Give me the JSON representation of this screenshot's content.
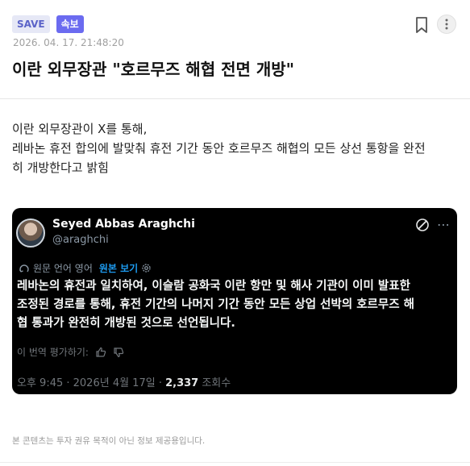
{
  "article": {
    "badges": {
      "save": "SAVE",
      "breaking": "속보"
    },
    "datetime": "2026. 04. 17. 21:48:20",
    "title": "이란 외무장관 \"호르무즈 해협 전면 개방\"",
    "body_lines": [
      "이란 외무장관이 X를 통해,",
      "레바논 휴전 합의에 발맞춰 휴전 기간 동안 호르무즈 해협의 모든 상선 통항을 완전",
      "히 개방한다고 밝힘"
    ]
  },
  "tweet": {
    "author_name": "Seyed Abbas Araghchi",
    "handle": "@araghchi",
    "original_language": "원문 언어 영어",
    "show_original": "원본 보기",
    "body_lines": [
      "레바논의 휴전과 일치하여, 이슬람 공화국 이란 항만 및 해사 기관이 이미 발표한",
      "조정된 경로를 통해, 휴전 기간의 나머지 기간 동안 모든 상업 선박의 호르무즈 해",
      "협 통과가 완전히 개방된 것으로 선언됩니다."
    ],
    "rate_translation": "이 번역 평가하기:",
    "timestamp": "오후 9:45 · 2026년 4월 17일 · ",
    "views_count": "2,337",
    "views_label": " 조회수"
  },
  "footer": {
    "disclaimer": "본 콘텐츠는 투자 권유 목적이 아닌 정보 제공용입니다."
  },
  "icons": {
    "bookmark": "bookmark-icon",
    "more": "more-vertical-icon",
    "x_logo": "x-logo-icon",
    "tweet_more": "more-horizontal-icon",
    "translate": "translate-icon",
    "settings": "gear-icon",
    "thumbs_up": "thumbs-up-icon",
    "thumbs_down": "thumbs-down-icon"
  },
  "colors": {
    "accent": "#6b6bf0",
    "tweet_bg": "#000000",
    "link": "#1d9bf0"
  }
}
